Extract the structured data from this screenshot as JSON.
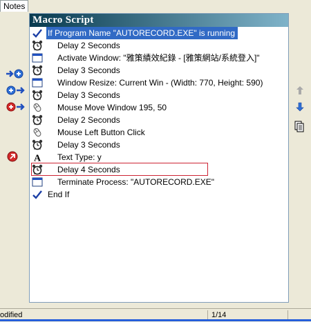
{
  "tab": {
    "label": "Notes"
  },
  "panel": {
    "title": "Macro Script"
  },
  "rows": [
    {
      "icon": "check-icon",
      "text": "If Program Name \"AUTORECORD.EXE\" is running",
      "selected": true
    },
    {
      "icon": "alarm-clock-icon",
      "text": "Delay 2 Seconds"
    },
    {
      "icon": "window-icon",
      "text": "Activate Window: \"雅策績效紀錄 - [雅策網站/系統登入]\""
    },
    {
      "icon": "alarm-clock-icon",
      "text": "Delay 3 Seconds"
    },
    {
      "icon": "window-icon",
      "text": "Window Resize: Current Win - (Width: 770, Height: 590)"
    },
    {
      "icon": "alarm-clock-icon",
      "text": "Delay 3 Seconds"
    },
    {
      "icon": "mouse-icon",
      "text": "Mouse Move Window 195, 50"
    },
    {
      "icon": "alarm-clock-icon",
      "text": "Delay 2 Seconds"
    },
    {
      "icon": "mouse-icon",
      "text": "Mouse Left Button Click"
    },
    {
      "icon": "alarm-clock-icon",
      "text": "Delay 3 Seconds"
    },
    {
      "icon": "text-type-icon",
      "text": "Text Type: y"
    },
    {
      "icon": "alarm-clock-icon",
      "text": "Delay 4 Seconds"
    },
    {
      "icon": "window-icon",
      "text": "Terminate Process: \"AUTORECORD.EXE\""
    },
    {
      "icon": "check-icon",
      "text": "End If"
    }
  ],
  "status": {
    "left": "odified",
    "position": "1/14"
  },
  "colors": {
    "title_start": "#083a4f",
    "title_end": "#7fb3c9",
    "selection": "#316ac5",
    "highlight_box": "#cc2233"
  }
}
